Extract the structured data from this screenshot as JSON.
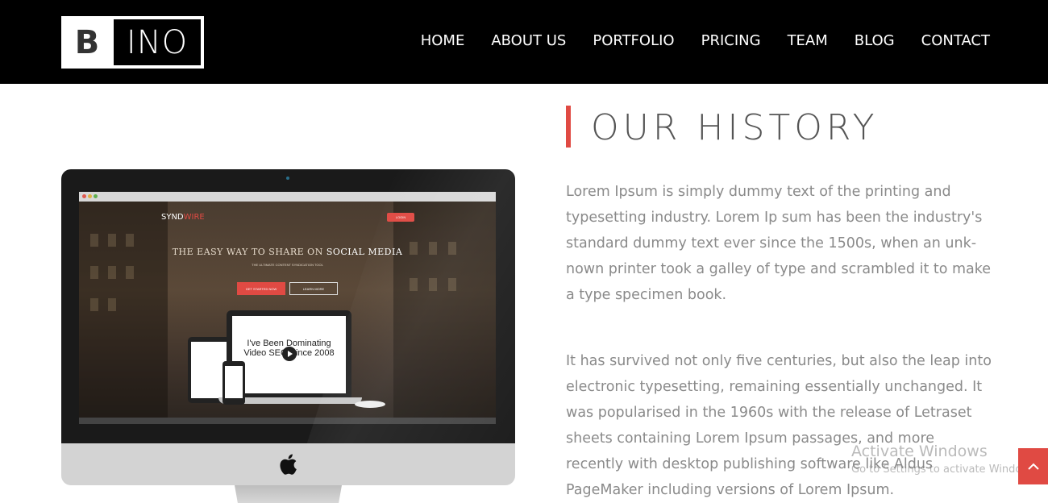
{
  "header": {
    "logo_left": "B",
    "logo_right": "INO",
    "nav": [
      "HOME",
      "ABOUT US",
      "PORTFOLIO",
      "PRICING",
      "TEAM",
      "BLOG",
      "CONTACT"
    ]
  },
  "mockup": {
    "brand_prefix": "SYND",
    "brand_suffix": "WIRE",
    "header_button": "LOGIN",
    "headline_pre": "THE EASY WAY TO SHARE ON",
    "headline_bold": "SOCIAL MEDIA",
    "subline": "THE ULTIMATE CONTENT SYNDICATION TOOL",
    "cta_primary": "GET STARTED NOW",
    "cta_secondary": "LEARN MORE",
    "laptop_text_line1": "I've Been Dominating",
    "laptop_text_line2": "Video SEO Since 2008"
  },
  "section": {
    "title": "OUR HISTORY",
    "accent_color": "#e04a43",
    "paragraph1": "Lorem Ipsum is simply dummy text of the printing and typesetting industry. Lorem Ip sum has been the industry's standard dummy text ever since the 1500s, when an unk- nown printer took a galley of type and scrambled it to make a type specimen book.",
    "paragraph2": "It has survived not only five centuries, but also the leap into electronic typesetting, remaining essentially unchanged. It was popularised in the 1960s with the release of Letraset sheets containing Lorem Ipsum passages, and more recently with desktop publishing software like Aldus PageMaker including versions of Lorem Ipsum."
  },
  "watermark": {
    "title": "Activate Windows",
    "subtitle": "Go to Settings to activate Windows."
  },
  "scroll_top": {
    "icon": "chevron-up-icon"
  }
}
